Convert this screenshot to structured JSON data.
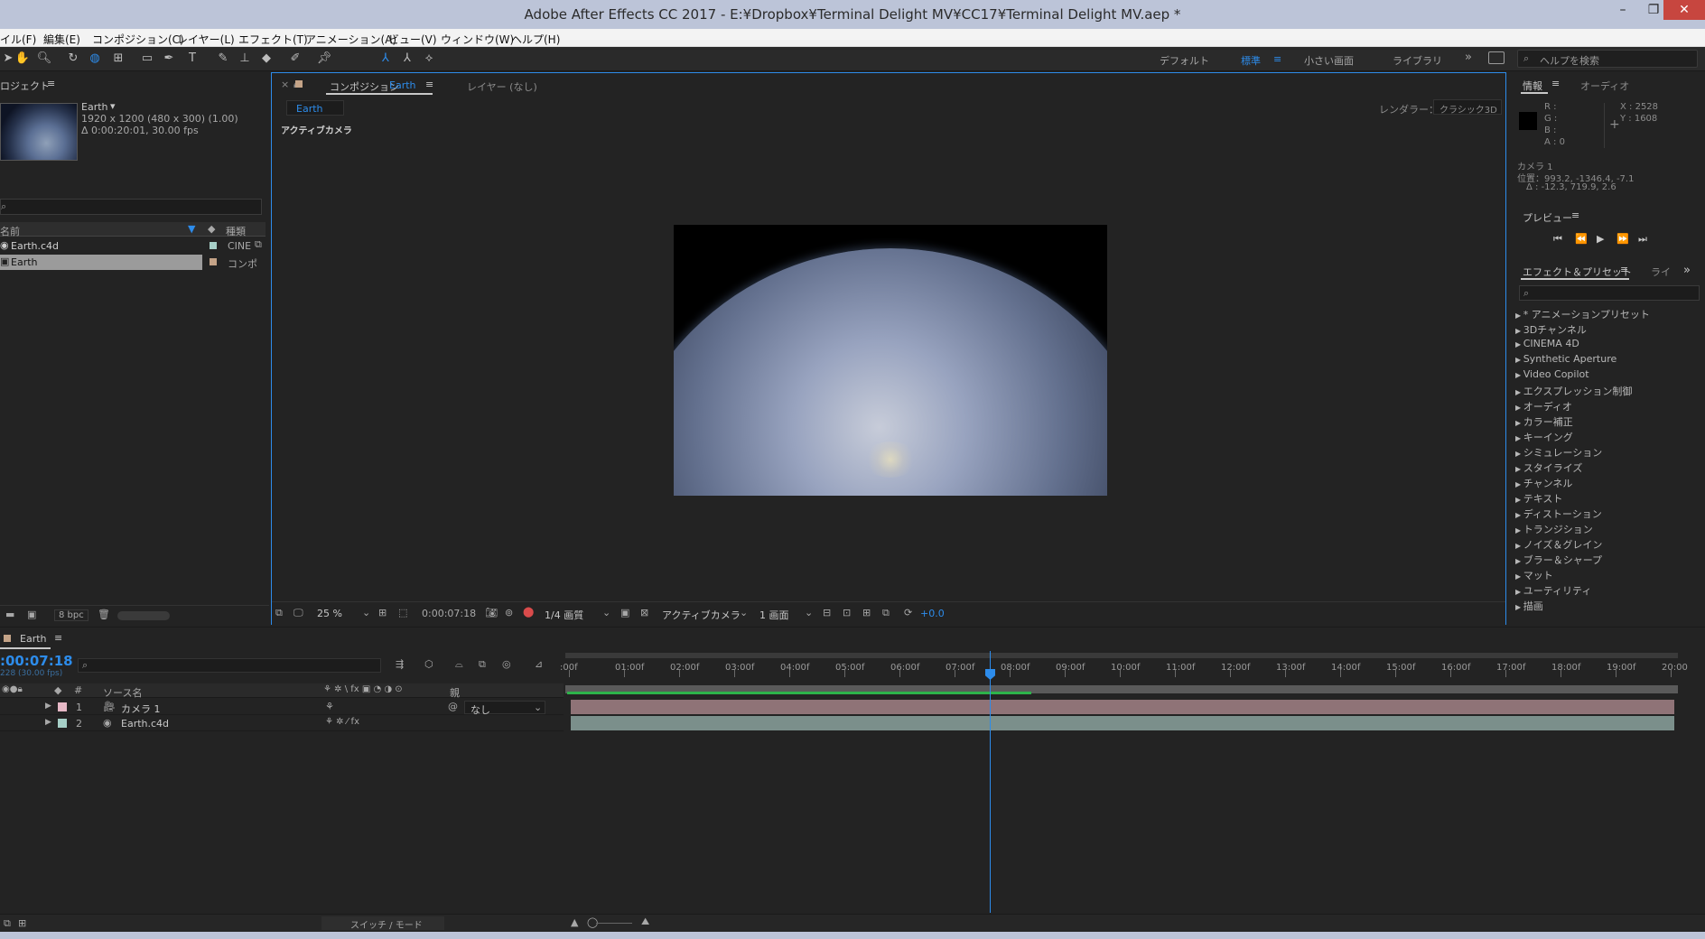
{
  "window": {
    "title": "Adobe After Effects CC 2017 - E:¥Dropbox¥Terminal Delight MV¥CC17¥Terminal Delight MV.aep *"
  },
  "menu": [
    "イル(F)",
    "編集(E)",
    "コンポジション(C)",
    "レイヤー(L)",
    "エフェクト(T)",
    "アニメーション(A)",
    "ビュー(V)",
    "ウィンドウ(W)",
    "ヘルプ(H)"
  ],
  "workspaces": {
    "default": "デフォルト",
    "standard": "標準",
    "small": "小さい画面",
    "library": "ライブラリ"
  },
  "help_search": {
    "placeholder": "ヘルプを検索"
  },
  "project": {
    "tab": "ロジェクト",
    "item_name": "Earth",
    "item_dims": "1920 x 1200  (480 x 300) (1.00)",
    "item_dur": "Δ 0:00:20:01, 30.00 fps",
    "col_name": "名前",
    "col_type": "種類",
    "items": [
      {
        "name": "Earth.c4d",
        "type": "CINE",
        "label_color": "#a6cfc7"
      },
      {
        "name": "Earth",
        "type": "コンポ",
        "label_color": "#c4a387"
      }
    ],
    "bpc": "8 bpc"
  },
  "composition": {
    "tab_prefix": "コンポジション",
    "tab_name": "Earth",
    "layer_tab": "レイヤー (なし)",
    "flow_tab": "Earth",
    "renderer_label": "レンダラー：",
    "renderer": "クラシック3D",
    "camera_label": "アクティブカメラ",
    "zoom": "25 %",
    "timecode": "0:00:07:18",
    "resolution": "1/4 画質",
    "view": "アクティブカメラ",
    "views": "1 画面",
    "exposure": "+0.0"
  },
  "info": {
    "tab": "情報",
    "tab2": "オーディオ",
    "r": "R :",
    "g": "G :",
    "b": "B :",
    "a": "A : 0",
    "x": "X : 2528",
    "y": "Y : 1608",
    "camera": "カメラ 1",
    "position": "位置：993.2, -1346.4, -7.1",
    "delta": "Δ : -12.3, 719.9, 2.6"
  },
  "preview": {
    "tab": "プレビュー"
  },
  "effects": {
    "tab": "エフェクト＆プリセット",
    "tab2": "ライ",
    "items": [
      "* アニメーションプリセット",
      "3Dチャンネル",
      "CINEMA 4D",
      "Synthetic Aperture",
      "Video Copilot",
      "エクスプレッション制御",
      "オーディオ",
      "カラー補正",
      "キーイング",
      "シミュレーション",
      "スタイライズ",
      "チャンネル",
      "テキスト",
      "ディストーション",
      "トランジション",
      "ノイズ＆グレイン",
      "ブラー＆シャープ",
      "マット",
      "ユーティリティ",
      "描画"
    ]
  },
  "timeline": {
    "tab": "Earth",
    "timecode": ":00:07:18",
    "fps": "228 (30.00 fps)",
    "col_source": "ソース名",
    "col_parent": "親",
    "layers": [
      {
        "num": "1",
        "name": "カメラ 1",
        "label_color": "#e6b8c6",
        "parent": "なし"
      },
      {
        "num": "2",
        "name": "Earth.c4d",
        "label_color": "#a6cfc7",
        "parent": ""
      }
    ],
    "ruler": [
      ":00f",
      "01:00f",
      "02:00f",
      "03:00f",
      "04:00f",
      "05:00f",
      "06:00f",
      "07:00f",
      "08:00f",
      "09:00f",
      "10:00f",
      "11:00f",
      "12:00f",
      "13:00f",
      "14:00f",
      "15:00f",
      "16:00f",
      "17:00f",
      "18:00f",
      "19:00f",
      "20:00"
    ],
    "switch_mode": "スイッチ / モード",
    "playhead_seconds": 7.6
  },
  "colors": {
    "accent": "#2d8ceb",
    "camera_bar": "#8f7377",
    "earth_bar": "#7b8f8b",
    "work_area": "#2db34a"
  }
}
